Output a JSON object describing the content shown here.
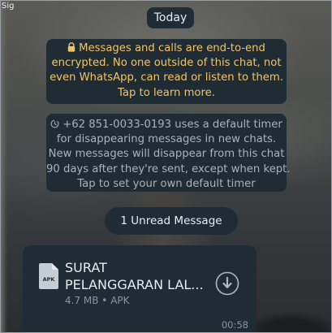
{
  "edge_text": "Sig",
  "date_chip": "Today",
  "encryption_notice": {
    "lines": [
      "Messages and calls are end-to-end",
      "encrypted. No one outside of this chat, not",
      "even WhatsApp, can read or listen to them.",
      "Tap to learn more."
    ],
    "icon": "lock-icon"
  },
  "timer_notice": {
    "lines": [
      "+62 851-0033-0193 uses a default timer",
      "for disappearing messages in new chats.",
      "New messages will disappear from this chat",
      "90 days after they're sent, except when kept.",
      "Tap to set your own default timer"
    ],
    "icon": "disappearing-timer-icon"
  },
  "unread_divider": "1 Unread Message",
  "message": {
    "file_name_lines": [
      "SURAT",
      "PELANGGARAN LAL..."
    ],
    "file_type_badge": "APK",
    "file_meta": "4.7 MB  •  APK",
    "time": "00:58",
    "download_icon": "download-icon"
  },
  "colors": {
    "bubble_bg": "#1f2c34",
    "encryption_text": "#f2c468",
    "system_text": "#a8b3ba",
    "primary_text": "#e9edef",
    "secondary_text": "#8696a0"
  }
}
